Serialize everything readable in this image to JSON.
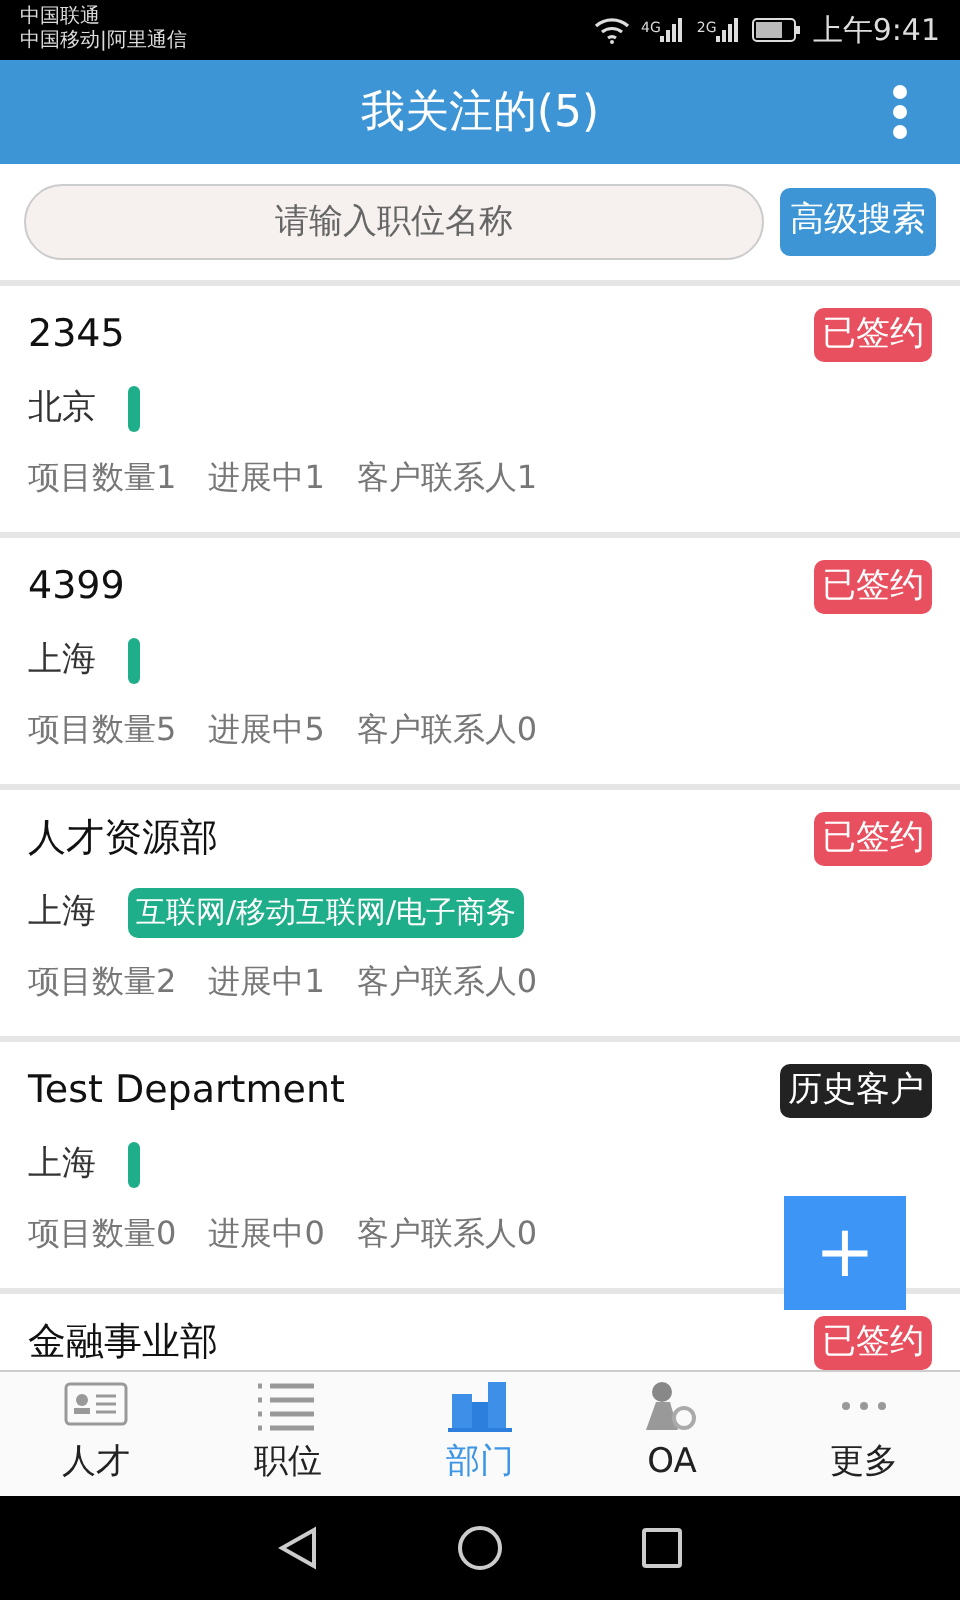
{
  "status_bar": {
    "carrier_1": "中国联通",
    "carrier_2": "中国移动|阿里通信",
    "network_1": "4G",
    "network_2": "2G",
    "time": "上午9:41"
  },
  "header": {
    "title": "我关注的(5)"
  },
  "search": {
    "placeholder": "请输入职位名称",
    "button": "高级搜索"
  },
  "departments": [
    {
      "name": "2345",
      "status": {
        "kind": "signed",
        "label": "已签约"
      },
      "city": "北京",
      "stats": [
        "项目数量1",
        "进展中1",
        "客户联系人1"
      ]
    },
    {
      "name": "4399",
      "status": {
        "kind": "signed",
        "label": "已签约"
      },
      "city": "上海",
      "stats": [
        "项目数量5",
        "进展中5",
        "客户联系人0"
      ]
    },
    {
      "name": "人才资源部",
      "status": {
        "kind": "signed",
        "label": "已签约"
      },
      "city": "上海",
      "tag": "互联网/移动互联网/电子商务",
      "stats": [
        "项目数量2",
        "进展中1",
        "客户联系人0"
      ]
    },
    {
      "name": "Test Department",
      "status": {
        "kind": "history",
        "label": "历史客户"
      },
      "city": "上海",
      "stats": [
        "项目数量0",
        "进展中0",
        "客户联系人0"
      ]
    },
    {
      "name": "金融事业部",
      "status": {
        "kind": "signed",
        "label": "已签约"
      }
    }
  ],
  "fab": {
    "label": "+"
  },
  "tabs": [
    {
      "label": "人才",
      "kind": "card",
      "selected": false
    },
    {
      "label": "职位",
      "kind": "list",
      "selected": false
    },
    {
      "label": "部门",
      "kind": "building",
      "selected": true
    },
    {
      "label": "OA",
      "kind": "person",
      "selected": false
    },
    {
      "label": "更多",
      "kind": "dots",
      "selected": false
    }
  ]
}
